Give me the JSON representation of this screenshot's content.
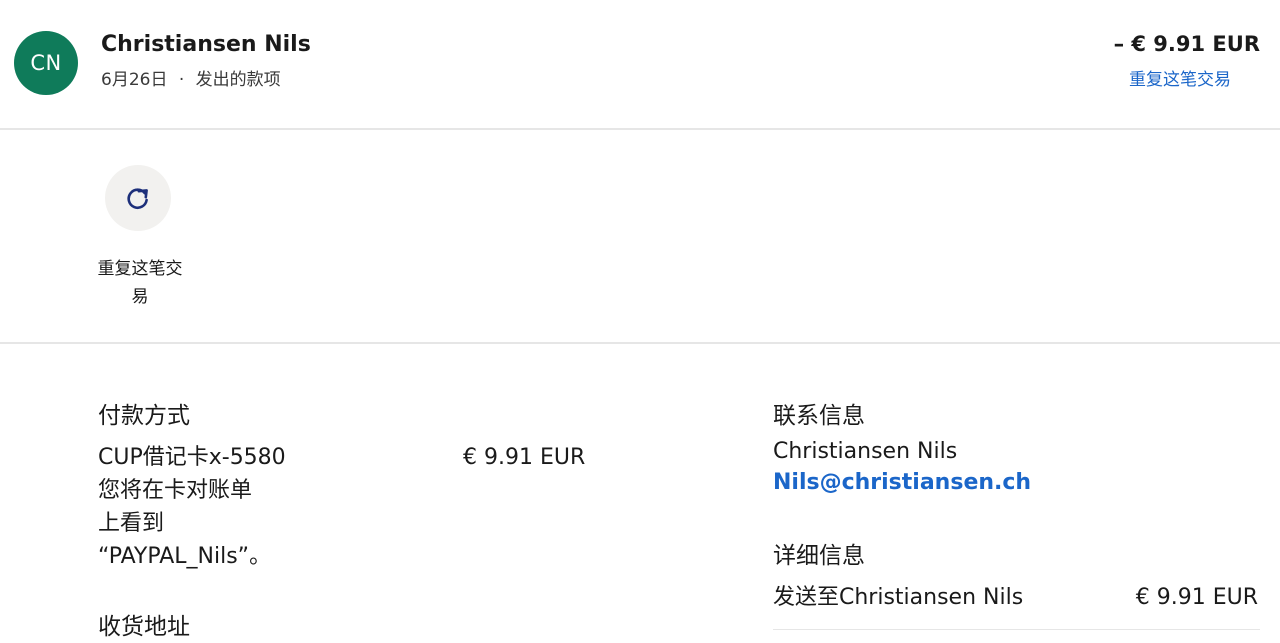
{
  "header": {
    "avatar_initials": "CN",
    "name": "Christiansen Nils",
    "date": "6月26日",
    "separator": "·",
    "type": "发出的款项",
    "amount": "– € 9.91 EUR",
    "repeat_link": "重复这笔交易"
  },
  "actions": {
    "repeat_icon": "refresh-icon",
    "repeat_label_line1": "重复这笔交",
    "repeat_label_line2": "易"
  },
  "payment": {
    "title": "付款方式",
    "method": "CUP借记卡x-5580",
    "amount": "€ 9.91 EUR",
    "statement_line1": "您将在卡对账单",
    "statement_line2": "上看到",
    "statement_line3": "“PAYPAL_Nils”。"
  },
  "shipping": {
    "title": "收货地址"
  },
  "contact": {
    "title": "联系信息",
    "name": "Christiansen Nils",
    "email": "Nils@christiansen.ch"
  },
  "details": {
    "title": "详细信息",
    "sent_to": "发送至Christiansen Nils",
    "amount": "€ 9.91 EUR"
  },
  "colors": {
    "avatar_bg": "#0f7b5a",
    "link": "#1b66c9",
    "icon": "#1d2f7a"
  }
}
